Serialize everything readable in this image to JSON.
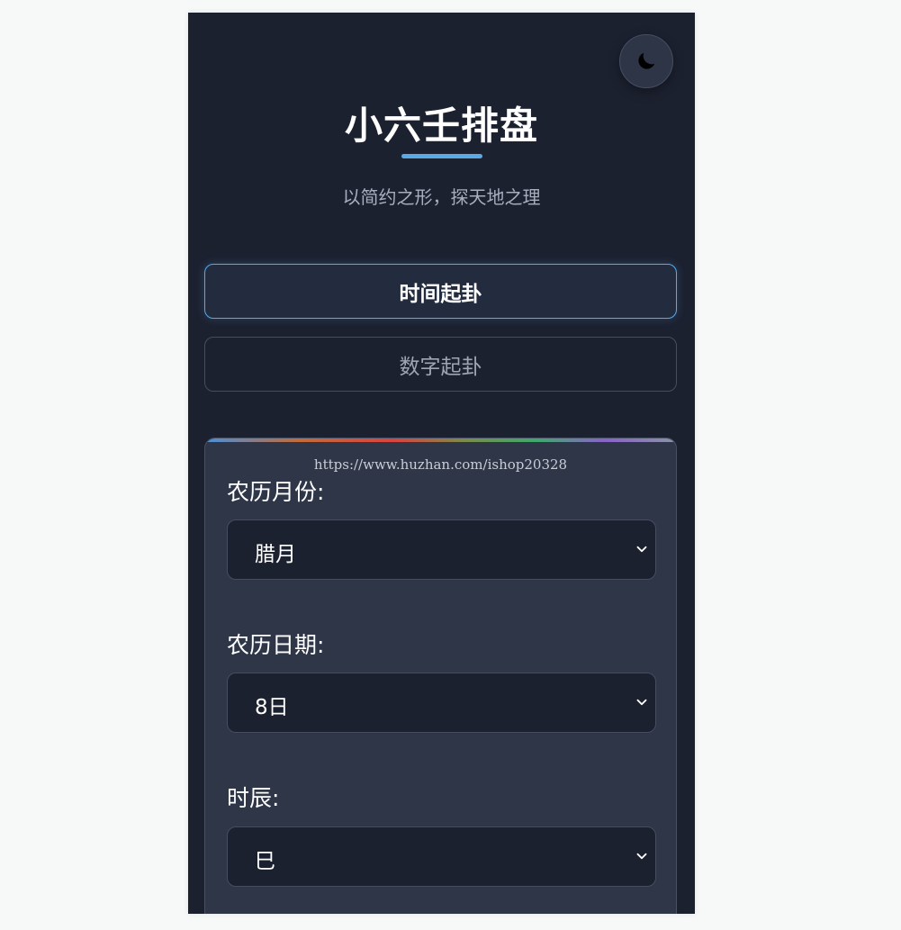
{
  "header": {
    "title": "小六壬排盘",
    "subtitle": "以简约之形，探天地之理"
  },
  "theme_toggle": {
    "icon": "moon-icon"
  },
  "modes": [
    {
      "label": "时间起卦",
      "active": true
    },
    {
      "label": "数字起卦",
      "active": false
    }
  ],
  "watermark": "https://www.huzhan.com/ishop20328",
  "form": {
    "month": {
      "label": "农历月份:",
      "value": "腊月"
    },
    "day": {
      "label": "农历日期:",
      "value": "8日"
    },
    "hour": {
      "label": "时辰:",
      "value": "巳"
    }
  },
  "colors": {
    "background": "#1c2130",
    "card": "#2e3648",
    "accent": "#5aa9e6",
    "text": "#ffffff",
    "muted": "#a7aebd"
  }
}
